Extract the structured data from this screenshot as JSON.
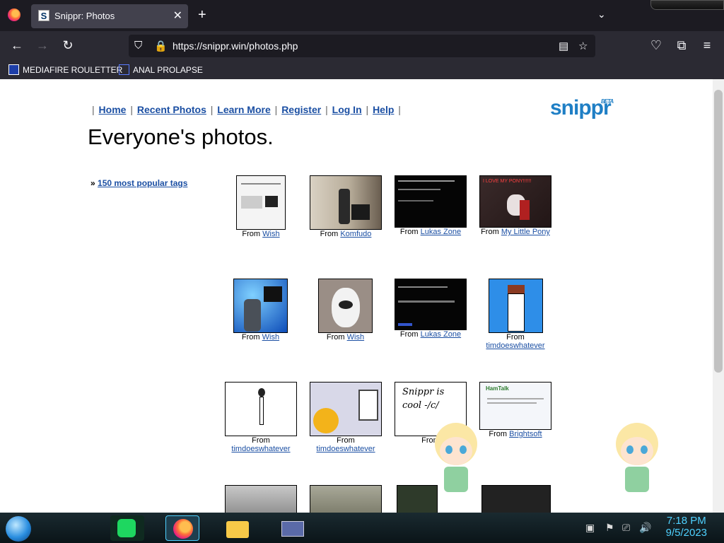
{
  "browser": {
    "tab_title": "Snippr: Photos",
    "favicon": "S",
    "url": "https://snippr.win/photos.php",
    "bookmarks": [
      {
        "label": "MEDIAFIRE ROULETTER",
        "icon": "mediafire-icon"
      },
      {
        "label": "ANAL PROLAPSE",
        "icon": "folder-icon"
      }
    ]
  },
  "page": {
    "nav": [
      "Home",
      "Recent Photos",
      "Learn More",
      "Register",
      "Log In",
      "Help"
    ],
    "logo": "snippr",
    "logo_badge": "BETA",
    "heading": "Everyone's photos.",
    "tags_prefix": "»",
    "tags_link": "150 most popular tags",
    "from_label": "From",
    "photos": [
      {
        "source": "Wish"
      },
      {
        "source": "Komfudo"
      },
      {
        "source": "Lukas Zone"
      },
      {
        "source": "My Little Pony",
        "caption": "I LOVE MY PONY!!!!!!"
      },
      {
        "source": "Wish"
      },
      {
        "source": "Wish"
      },
      {
        "source": "Lukas Zone"
      },
      {
        "source": "timdoeswhatever"
      },
      {
        "source": "timdoeswhatever"
      },
      {
        "source": "timdoeswhatever"
      },
      {
        "source": "",
        "caption": "Snippr is cool -/c/"
      },
      {
        "source": "Brightsoft",
        "caption": "HamTalk"
      }
    ]
  },
  "taskbar": {
    "time": "7:18 PM",
    "date": "9/5/2023"
  },
  "colors": {
    "link": "#1b4fa3",
    "logo": "#1f7fc5",
    "clock": "#4fd1ff"
  }
}
